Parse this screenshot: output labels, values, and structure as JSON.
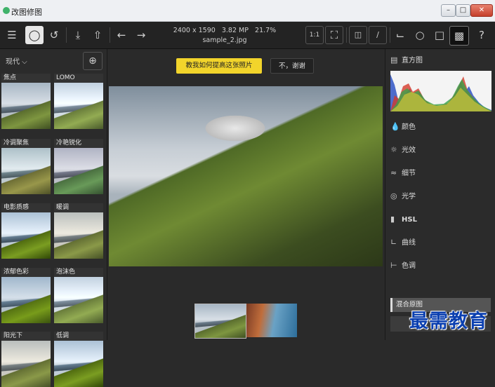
{
  "window": {
    "title": "改图修图"
  },
  "toolbar": {
    "image_size": "2400 x 1590",
    "megapixels": "3.82 MP",
    "zoom": "21.7%",
    "filename": "sample_2.jpg",
    "zoom_fit_label": "1:1",
    "help_label": "?"
  },
  "left_panel": {
    "filter_label": "现代 ⌵",
    "presets": [
      {
        "label": "焦点"
      },
      {
        "label": "LOMO"
      },
      {
        "label": "冷调聚焦"
      },
      {
        "label": "冷艳锐化"
      },
      {
        "label": "电影质感"
      },
      {
        "label": "暖调"
      },
      {
        "label": "浓郁色彩"
      },
      {
        "label": "泡沫色"
      },
      {
        "label": "阳光下"
      },
      {
        "label": "低调"
      }
    ]
  },
  "banner": {
    "tip_button": "教我如何提高这张照片",
    "dismiss_button": "不，谢谢"
  },
  "right_panel": {
    "histogram_label": "直方图",
    "items": [
      "颜色",
      "光效",
      "细节",
      "光学",
      "HSL",
      "曲线",
      "色调"
    ],
    "blend_label": "混合原图"
  },
  "watermark": {
    "text": "最需教育"
  }
}
